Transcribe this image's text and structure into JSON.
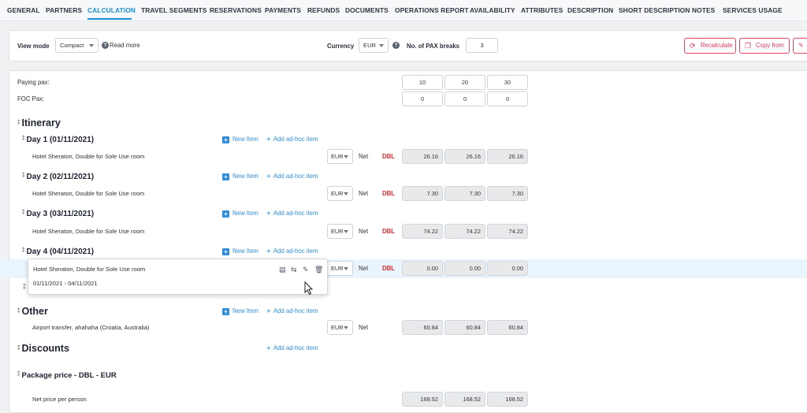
{
  "tabs": [
    {
      "label": "GENERAL",
      "active": false
    },
    {
      "label": "PARTNERS",
      "active": false
    },
    {
      "label": "CALCULATION",
      "active": true
    },
    {
      "label": "TRAVEL SEGMENTS",
      "active": false
    },
    {
      "label": "RESERVATIONS",
      "active": false
    },
    {
      "label": "PAYMENTS",
      "active": false
    },
    {
      "label": "REFUNDS",
      "active": false
    },
    {
      "label": "DOCUMENTS",
      "active": false
    },
    {
      "label": "OPERATIONS REPORT",
      "active": false
    },
    {
      "label": "AVAILABILITY",
      "active": false
    },
    {
      "label": "ATTRIBUTES",
      "active": false
    },
    {
      "label": "DESCRIPTION",
      "active": false
    },
    {
      "label": "SHORT DESCRIPTION",
      "active": false
    },
    {
      "label": "NOTES",
      "active": false
    },
    {
      "label": "SERVICES USAGE",
      "active": false
    }
  ],
  "toolbar": {
    "view_mode_label": "View mode",
    "view_mode_value": "Compact",
    "read_more": "Read more",
    "currency_label": "Currency",
    "currency_value": "EUR",
    "pax_breaks_label": "No. of PAX breaks",
    "pax_breaks_value": "3",
    "recalculate": "Recalculate",
    "copy_from": "Copy from"
  },
  "pax": {
    "paying_label": "Paying pax:",
    "paying_values": [
      "10",
      "20",
      "30"
    ],
    "foc_label": "FOC Pax:",
    "foc_values": [
      "0",
      "0",
      "0"
    ]
  },
  "itinerary": {
    "title": "Itinerary",
    "new_item": "New Item",
    "add_adhoc": "Add ad-hoc item",
    "currency": "EUR",
    "net": "Net",
    "room_type": "DBL",
    "days": [
      {
        "title": "Day 1 (01/11/2021)",
        "item": "Hotel Sheraton, Double for Sole Use room",
        "values": [
          "26.16",
          "26.16",
          "26.16"
        ]
      },
      {
        "title": "Day 2 (02/11/2021)",
        "item": "Hotel Sheraton, Double for Sole Use room",
        "values": [
          "7.30",
          "7.30",
          "7.30"
        ]
      },
      {
        "title": "Day 3 (03/11/2021)",
        "item": "Hotel Sheraton, Double for Sole Use room",
        "values": [
          "74.22",
          "74.22",
          "74.22"
        ]
      },
      {
        "title": "Day 4 (04/11/2021)",
        "item": "Hotel Sheraton, Double for Sole Use room",
        "values": [
          "0.00",
          "0.00",
          "0.00"
        ]
      }
    ]
  },
  "popover": {
    "item": "Hotel Sheraton, Double for Sole Use room",
    "dates": "01/11/2021 - 04/11/2021"
  },
  "other": {
    "title": "Other",
    "item": "Airport transfer, ahahaha (Croatia, Australia)",
    "currency": "EUR",
    "net": "Net",
    "values": [
      "60.84",
      "60.84",
      "60.84"
    ]
  },
  "discounts": {
    "title": "Discounts",
    "add_adhoc": "Add ad-hoc item"
  },
  "package": {
    "title": "Package price - DBL - EUR",
    "net_label": "Net price per person",
    "values": [
      "168.52",
      "168.52",
      "168.52"
    ]
  },
  "colors": {
    "accent": "#1b8fd6",
    "danger": "#d8365a",
    "link": "#2f8fdb"
  }
}
